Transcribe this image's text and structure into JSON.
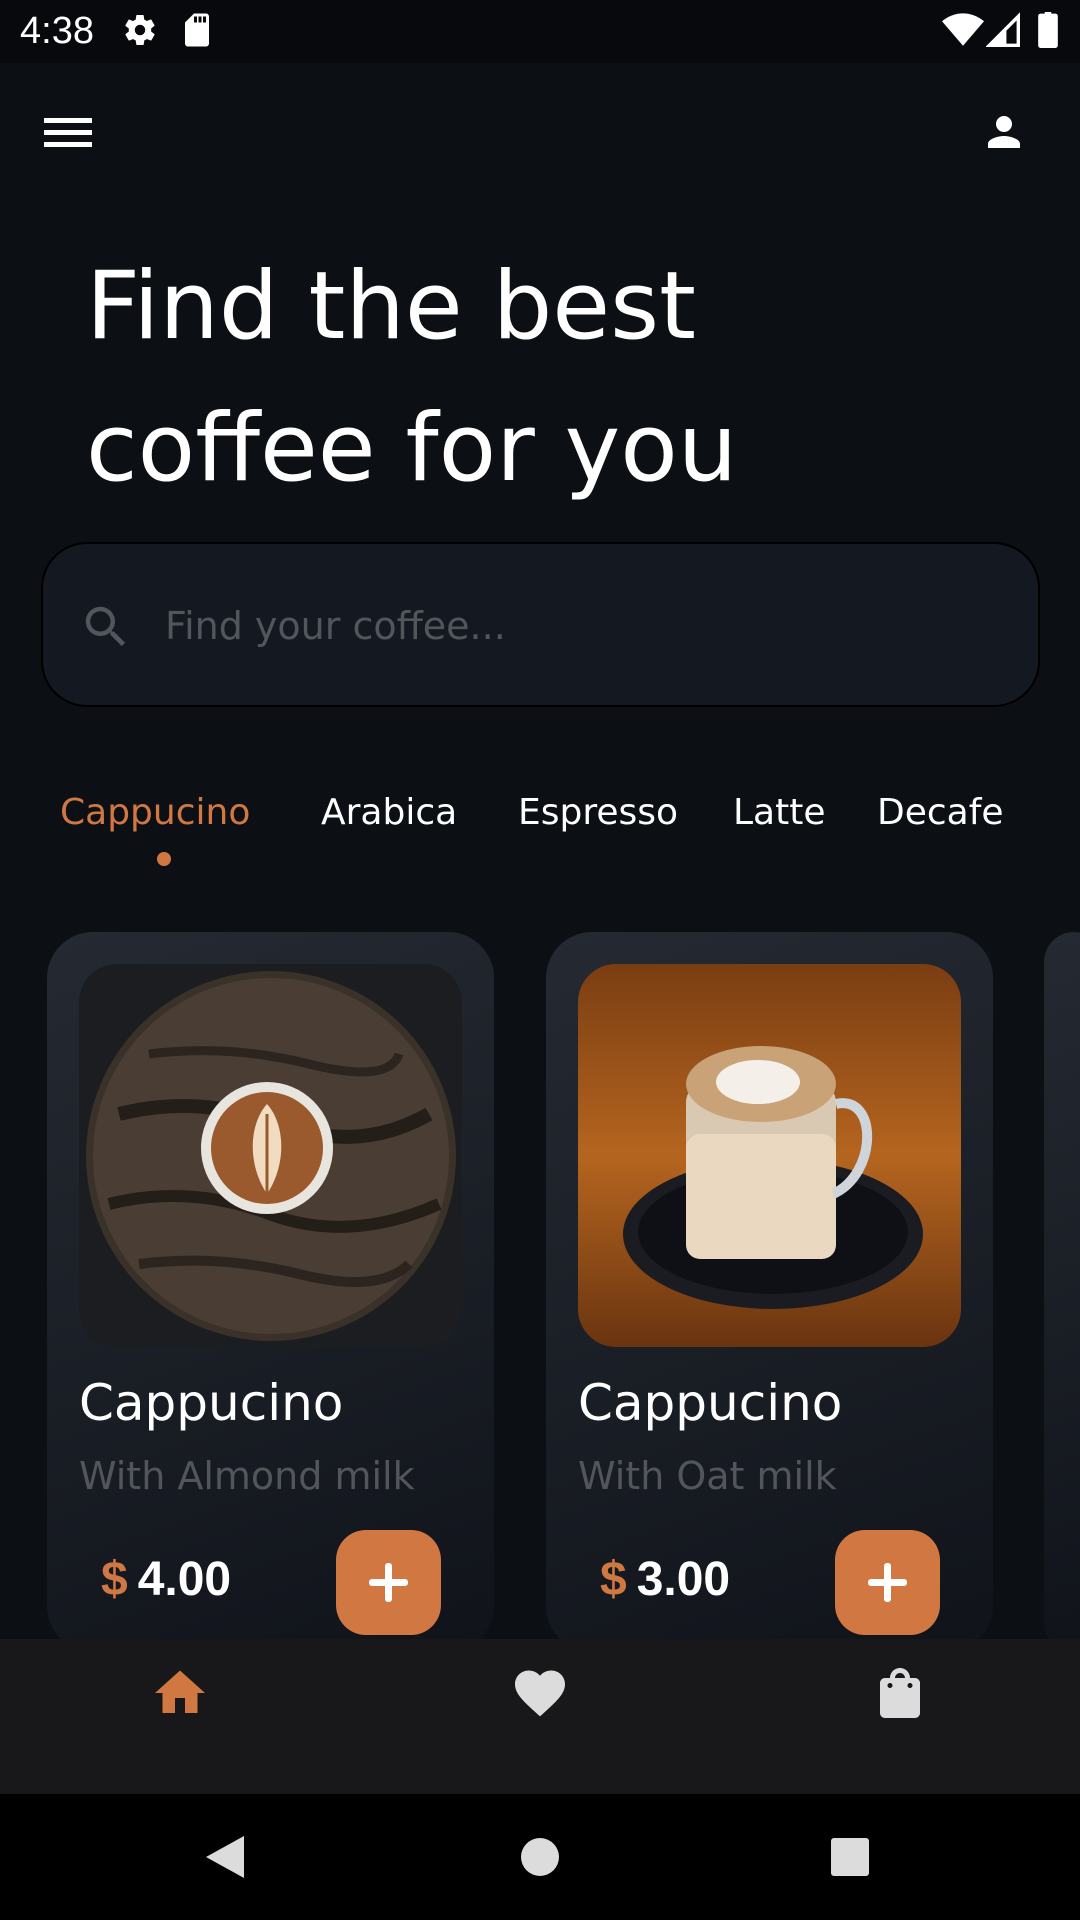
{
  "status_bar": {
    "time": "4:38",
    "left_icons": [
      "gear-icon",
      "sd-card-icon"
    ],
    "right_icons": [
      "wifi-icon",
      "signal-icon",
      "battery-icon"
    ]
  },
  "top_bar": {
    "menu_icon": "menu-icon",
    "profile_icon": "person-icon"
  },
  "headline": {
    "line1": "Find the best",
    "line2": "coffee for you"
  },
  "search": {
    "placeholder": "Find your coffee...",
    "value": ""
  },
  "categories": {
    "items": [
      "Cappucino",
      "Arabica",
      "Espresso",
      "Latte",
      "Decafe"
    ],
    "active_index": 0
  },
  "products": [
    {
      "name": "Cappucino",
      "subtitle": "With Almond milk",
      "currency": "$",
      "price": "4.00"
    },
    {
      "name": "Cappucino",
      "subtitle": "With Oat milk",
      "currency": "$",
      "price": "3.00"
    }
  ],
  "bottom_nav": {
    "items": [
      "home-icon",
      "heart-icon",
      "bag-icon"
    ],
    "active_index": 0
  },
  "system_nav": [
    "back-icon",
    "home-circle-icon",
    "recents-icon"
  ],
  "colors": {
    "accent": "#d17842",
    "background": "#0c0f14",
    "card": "#252a32",
    "muted_text": "#52555a",
    "nav_inactive": "#dcdcdc"
  }
}
